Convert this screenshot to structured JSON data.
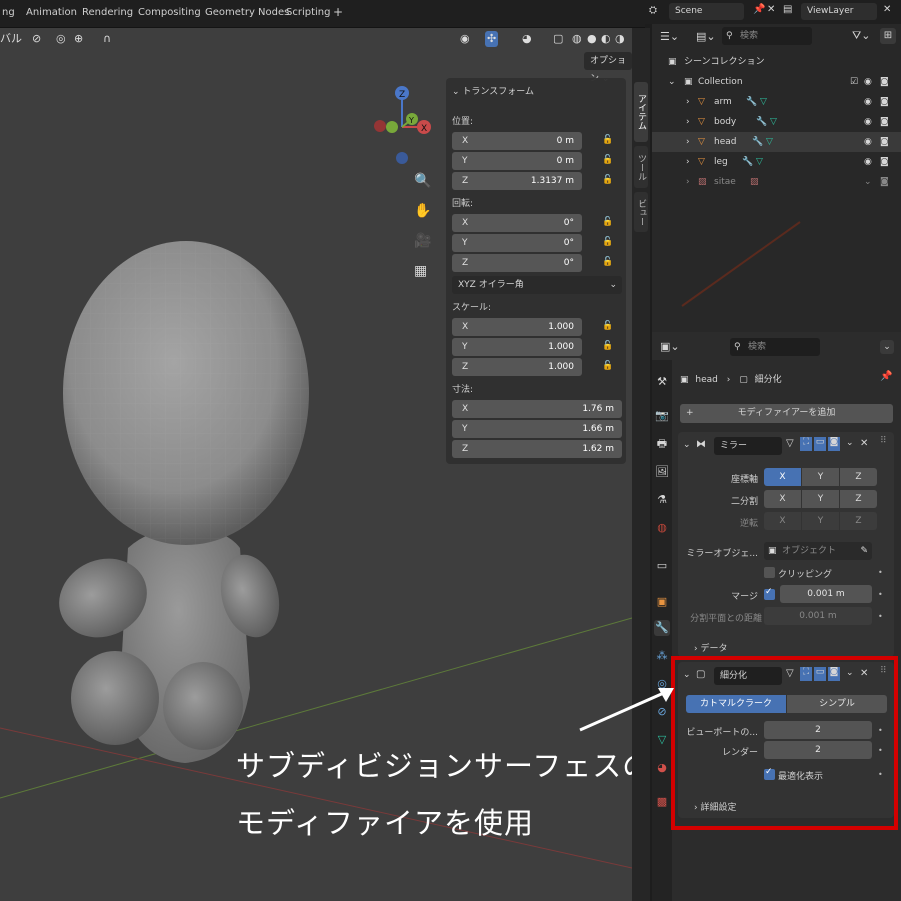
{
  "topbar": {
    "tabs": [
      "ng",
      "Animation",
      "Rendering",
      "Compositing",
      "Geometry Nodes",
      "Scripting",
      "+"
    ]
  },
  "header_right": {
    "scene": "Scene",
    "view_layer": "ViewLayer"
  },
  "viewport": {
    "header_left": "バル",
    "options_label": "オプション"
  },
  "npanel": {
    "title": "トランスフォーム",
    "location_label": "位置:",
    "location": [
      {
        "axis": "X",
        "value": "0 m"
      },
      {
        "axis": "Y",
        "value": "0 m"
      },
      {
        "axis": "Z",
        "value": "1.3137 m"
      }
    ],
    "rotation_label": "回転:",
    "rotation": [
      {
        "axis": "X",
        "value": "0°"
      },
      {
        "axis": "Y",
        "value": "0°"
      },
      {
        "axis": "Z",
        "value": "0°"
      }
    ],
    "rotation_mode": "XYZ オイラー角",
    "scale_label": "スケール:",
    "scale": [
      {
        "axis": "X",
        "value": "1.000"
      },
      {
        "axis": "Y",
        "value": "1.000"
      },
      {
        "axis": "Z",
        "value": "1.000"
      }
    ],
    "dimensions_label": "寸法:",
    "dimensions": [
      {
        "axis": "X",
        "value": "1.76 m"
      },
      {
        "axis": "Y",
        "value": "1.66 m"
      },
      {
        "axis": "Z",
        "value": "1.62 m"
      }
    ]
  },
  "sidebar_tabs": [
    "アイテム",
    "ツール",
    "ビュー"
  ],
  "outliner": {
    "search_placeholder": "検索",
    "scene_collection": "シーンコレクション",
    "collection": "Collection",
    "objects": [
      "arm",
      "body",
      "head",
      "leg",
      "sitae"
    ]
  },
  "properties": {
    "search_placeholder": "検索",
    "breadcrumb_object": "head",
    "breadcrumb_modifier": "細分化",
    "add_modifier": "モディファイアーを追加",
    "mirror": {
      "name": "ミラー",
      "axis_label": "座標軸",
      "bisect_label": "二分割",
      "flip_label": "逆転",
      "axes": [
        "X",
        "Y",
        "Z"
      ],
      "mirror_object_label": "ミラーオブジェ...",
      "mirror_object_placeholder": "オブジェクト",
      "clipping_label": "クリッピング",
      "merge_label": "マージ",
      "merge_value": "0.001 m",
      "bisect_distance_label": "分割平面との距離",
      "bisect_distance_value": "0.001 m",
      "data_label": "データ"
    },
    "subsurf": {
      "name": "細分化",
      "catmull_label": "カトマルクラーク",
      "simple_label": "シンプル",
      "viewport_label": "ビューポートの...",
      "viewport_value": "2",
      "render_label": "レンダー",
      "render_value": "2",
      "optimal_label": "最適化表示",
      "advanced_label": "詳細設定"
    }
  },
  "annotation": {
    "line1": "サブディビジョンサーフェスの",
    "line2": "モディファイアを使用"
  },
  "colors": {
    "accent": "#4772b3",
    "highlight": "#d40000"
  }
}
